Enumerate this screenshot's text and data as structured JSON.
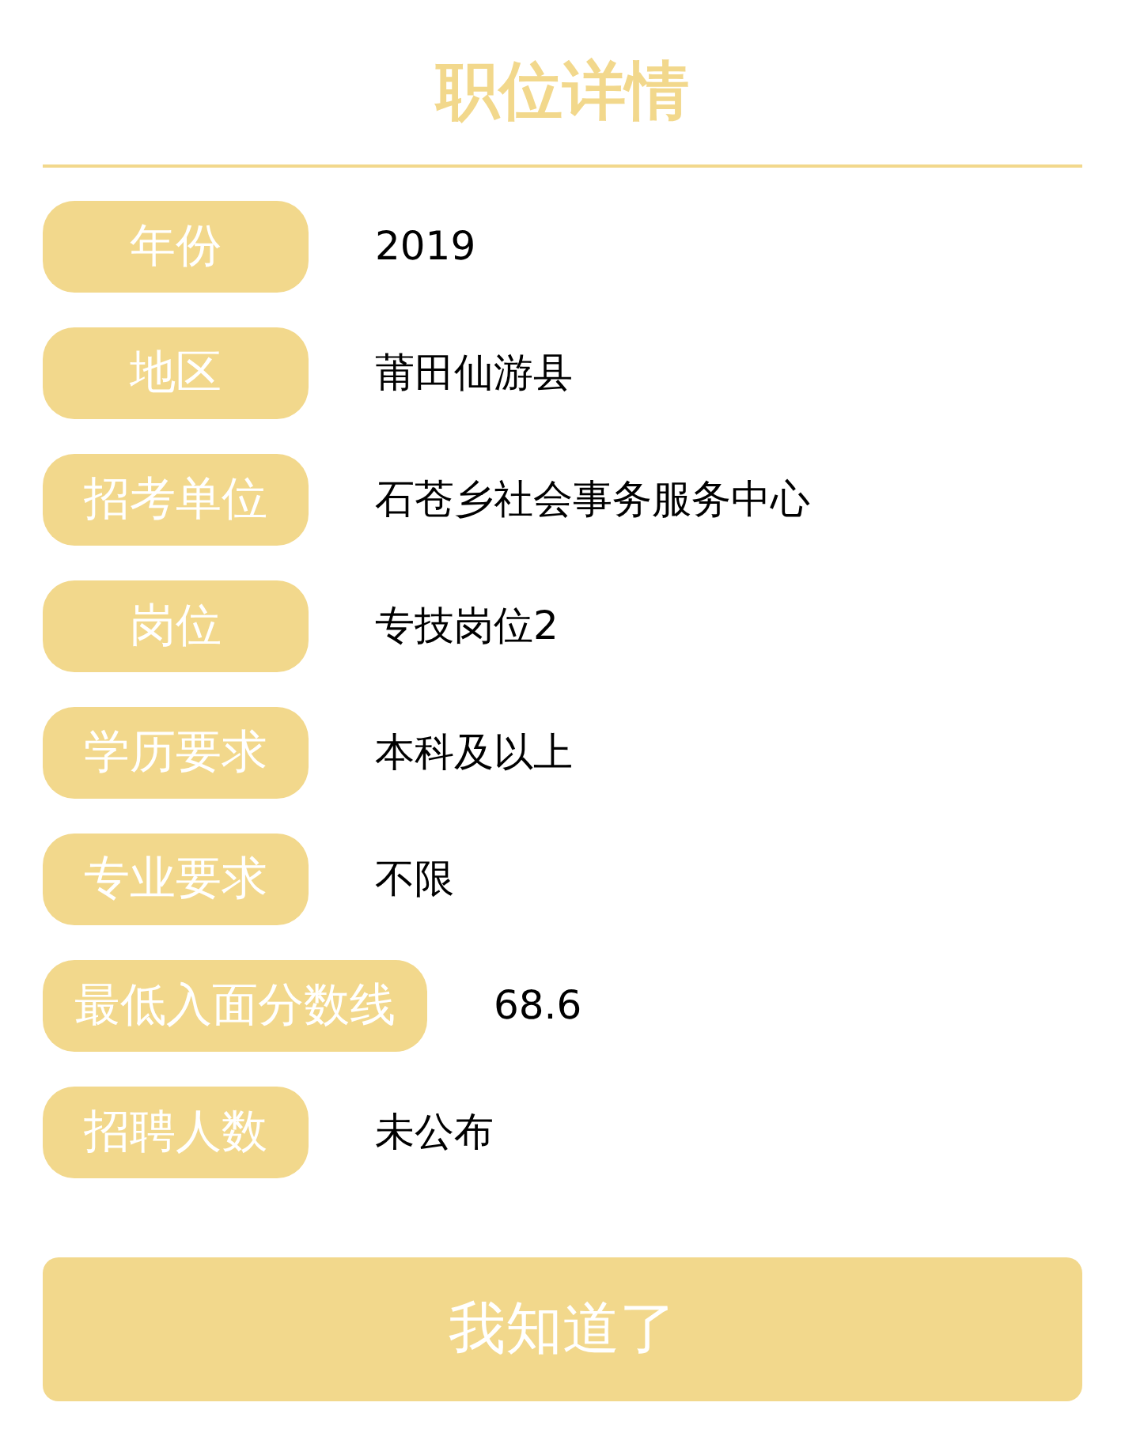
{
  "title": "职位详情",
  "rows": [
    {
      "label": "年份",
      "value": "2019"
    },
    {
      "label": "地区",
      "value": "莆田仙游县"
    },
    {
      "label": "招考单位",
      "value": "石苍乡社会事务服务中心"
    },
    {
      "label": "岗位",
      "value": "专技岗位2"
    },
    {
      "label": "学历要求",
      "value": "本科及以上"
    },
    {
      "label": "专业要求",
      "value": "不限"
    },
    {
      "label": "最低入面分数线",
      "value": "68.6"
    },
    {
      "label": "招聘人数",
      "value": "未公布"
    }
  ],
  "button": "我知道了"
}
